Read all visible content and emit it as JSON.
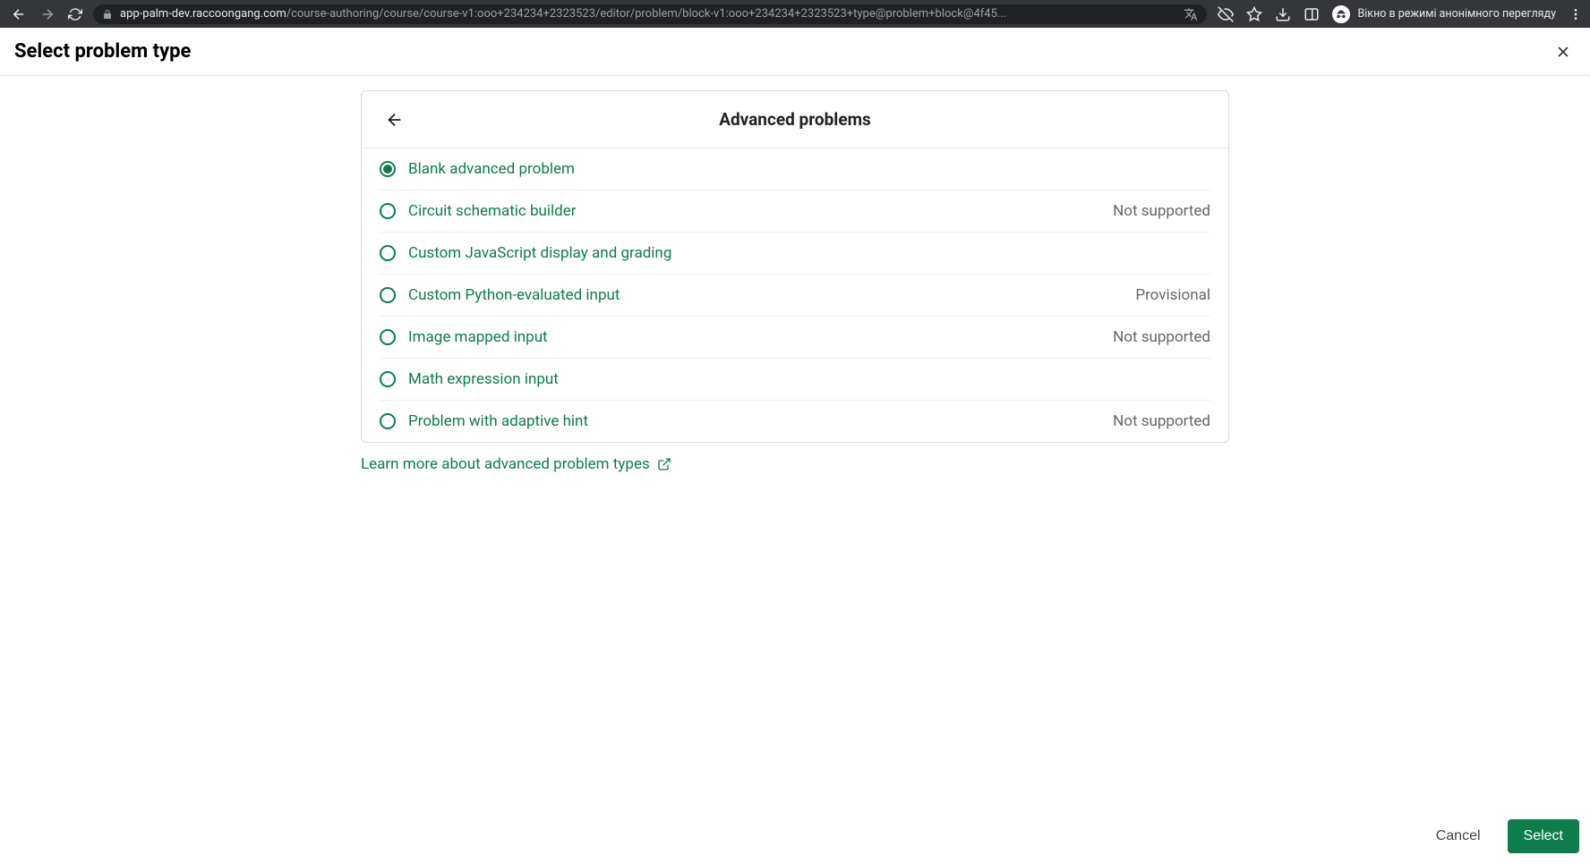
{
  "browser": {
    "url_domain": "app-palm-dev.raccoongang.com",
    "url_path": "/course-authoring/course/course-v1:ooo+234234+2323523/editor/problem/block-v1:ooo+234234+2323523+type@problem+block@4f45...",
    "incognito_text": "Вікно в режимі анонімного перегляду"
  },
  "header": {
    "title": "Select problem type"
  },
  "card": {
    "title": "Advanced problems"
  },
  "options": [
    {
      "label": "Blank advanced problem",
      "status": "",
      "selected": true
    },
    {
      "label": "Circuit schematic builder",
      "status": "Not supported",
      "selected": false
    },
    {
      "label": "Custom JavaScript display and grading",
      "status": "",
      "selected": false
    },
    {
      "label": "Custom Python-evaluated input",
      "status": "Provisional",
      "selected": false
    },
    {
      "label": "Image mapped input",
      "status": "Not supported",
      "selected": false
    },
    {
      "label": "Math expression input",
      "status": "",
      "selected": false
    },
    {
      "label": "Problem with adaptive hint",
      "status": "Not supported",
      "selected": false
    }
  ],
  "learn_more": {
    "text": "Learn more about advanced problem types"
  },
  "footer": {
    "cancel": "Cancel",
    "select": "Select"
  }
}
